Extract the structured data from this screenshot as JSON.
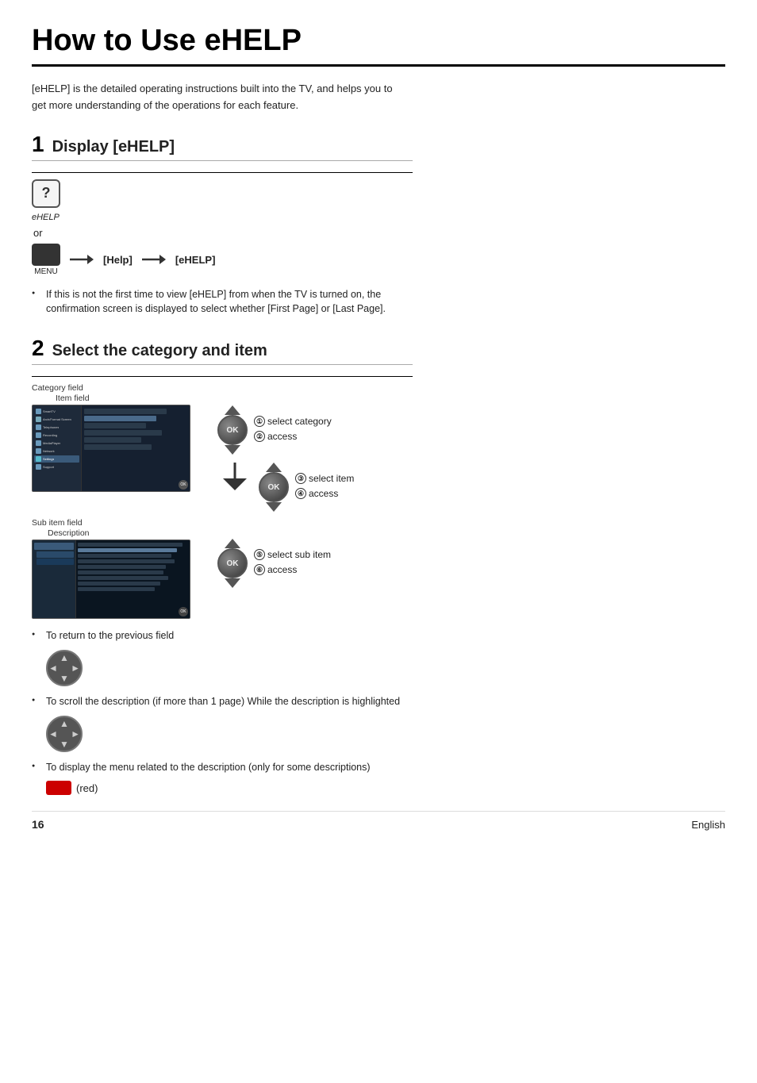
{
  "page": {
    "title": "How to Use eHELP",
    "page_number": "16",
    "language": "English"
  },
  "intro": {
    "text": "[eHELP] is the detailed operating instructions built into the TV, and helps you to get more understanding of the operations for each feature."
  },
  "section1": {
    "number": "1",
    "heading": "Display [eHELP]",
    "ehelp_icon_label": "?",
    "ehelp_text": "eHELP",
    "or_text": "or",
    "menu_label": "MENU",
    "help_label": "[Help]",
    "ehelp_label": "[eHELP]",
    "bullet": "If this is not the first time to view [eHELP] from when the TV is turned on, the confirmation screen is displayed to select whether [First Page] or [Last Page]."
  },
  "section2": {
    "number": "2",
    "heading": "Select the category and item",
    "field_labels": {
      "category": "Category field",
      "item": "Item field"
    },
    "steps": {
      "step1": "select category",
      "step2": "access",
      "step3": "select item",
      "step4": "access",
      "step5": "select sub item",
      "step6": "access"
    },
    "sub_field_labels": {
      "sub_item": "Sub item field",
      "description": "Description"
    },
    "bullets": [
      "To return to the previous field",
      "To scroll the description (if more than 1 page) While the description is highlighted",
      "To display the menu related to the description (only for some descriptions)"
    ],
    "red_button_label": "(red)"
  }
}
